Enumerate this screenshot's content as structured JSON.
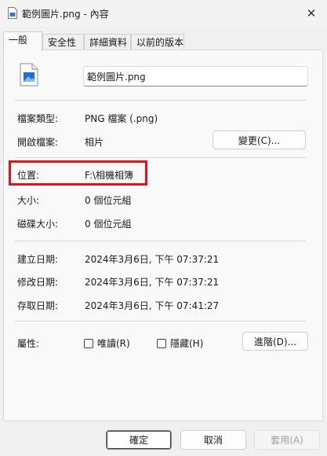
{
  "window": {
    "title": "範例圖片.png - 內容",
    "title_icon": "image-file-icon",
    "close_glyph": "✕"
  },
  "tabs": [
    {
      "label": "一般",
      "active": true
    },
    {
      "label": "安全性",
      "active": false
    },
    {
      "label": "詳細資料",
      "active": false
    },
    {
      "label": "以前的版本",
      "active": false
    }
  ],
  "general": {
    "file_icon": "png-image-file-icon",
    "file_name": "範例圖片.png",
    "file_type_label": "檔案類型:",
    "file_type_value": "PNG 檔案 (.png)",
    "opens_with_label": "開啟檔案:",
    "opens_with_value": "相片",
    "change_button": "變更(C)...",
    "location_label": "位置:",
    "location_value": "F:\\相機相簿",
    "size_label": "大小:",
    "size_value": "0 個位元組",
    "size_on_disk_label": "磁碟大小:",
    "size_on_disk_value": "0 個位元組",
    "created_label": "建立日期:",
    "created_value": "2024年3月6日, 下午 07:37:21",
    "modified_label": "修改日期:",
    "modified_value": "2024年3月6日, 下午 07:37:21",
    "accessed_label": "存取日期:",
    "accessed_value": "2024年3月6日, 下午 07:41:27",
    "attributes_label": "屬性:",
    "readonly_label": "唯讀(R)",
    "readonly_checked": false,
    "hidden_label": "隱藏(H)",
    "hidden_checked": false,
    "advanced_button": "進階(D)..."
  },
  "footer": {
    "ok": "確定",
    "cancel": "取消",
    "apply": "套用(A)"
  },
  "colors": {
    "highlight_box": "#e0141a",
    "accent_blue": "#1f6fd1"
  }
}
